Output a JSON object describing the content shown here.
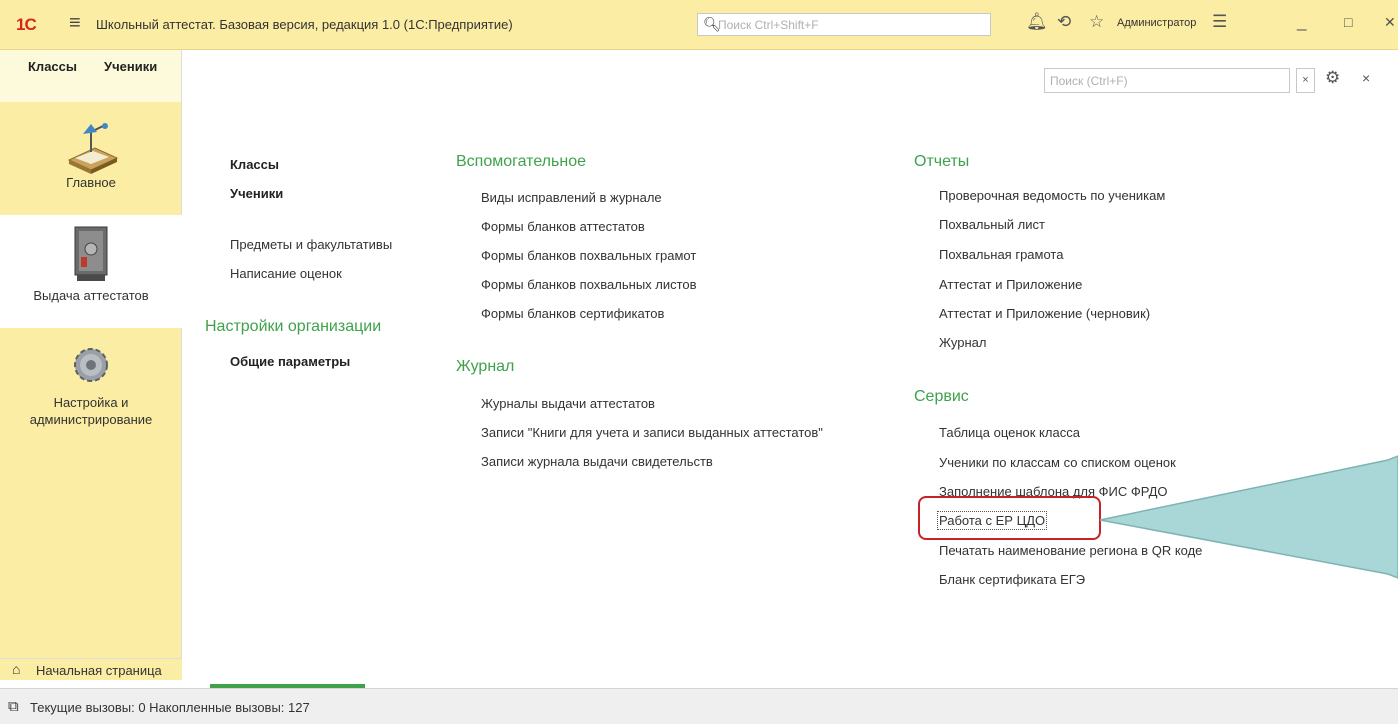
{
  "window": {
    "logo": "1С",
    "title": "Школьный аттестат. Базовая версия, редакция 1.0  (1С:Предприятие)",
    "search_placeholder": "Поиск Ctrl+Shift+F",
    "user": "Администратор",
    "minimize": "_",
    "maximize": "□",
    "close": "✕"
  },
  "section_tabs": [
    "Классы",
    "Ученики"
  ],
  "sidebar": {
    "items": [
      {
        "label": "Главное",
        "icon": "desk-lamp-icon"
      },
      {
        "label": "Выдача аттестатов",
        "icon": "safe-icon",
        "active": true
      },
      {
        "label": "Настройка и администрирование",
        "icon": "gears-icon"
      }
    ],
    "home": "Начальная страница"
  },
  "form": {
    "search_placeholder": "Поиск (Ctrl+F)",
    "clear": "×",
    "close": "×"
  },
  "columns": {
    "left": {
      "items": [
        "Классы",
        "Ученики",
        "Предметы и факультативы",
        "Написание оценок"
      ],
      "section": "Настройки организации",
      "section_items": [
        "Общие параметры"
      ]
    },
    "middle": {
      "section1": "Вспомогательное",
      "section1_items": [
        "Виды исправлений в журнале",
        "Формы бланков аттестатов",
        "Формы бланков похвальных грамот",
        "Формы бланков похвальных листов",
        "Формы бланков сертификатов"
      ],
      "section2": "Журнал",
      "section2_items": [
        "Журналы выдачи аттестатов",
        "Записи \"Книги для учета и записи выданных аттестатов\"",
        "Записи журнала выдачи свидетельств"
      ]
    },
    "right": {
      "section1": "Отчеты",
      "section1_items": [
        "Проверочная ведомость по ученикам",
        "Похвальный лист",
        "Похвальная грамота",
        "Аттестат и Приложение",
        "Аттестат и Приложение (черновик)",
        "Журнал"
      ],
      "section2": "Сервис",
      "section2_items": [
        "Таблица оценок класса",
        "Ученики по классам со списком оценок",
        "Заполнение шаблона для ФИС ФРДО",
        "Работа с ЕР ЦДО",
        "Печатать наименование региона в QR коде",
        "Бланк сертификата ЕГЭ"
      ]
    }
  },
  "status": {
    "text": "Текущие вызовы: 0   Накопленные вызовы: 127"
  },
  "colors": {
    "accent": "#3fa24b",
    "panel": "#fbeda3",
    "highlight": "#c62326",
    "callout": "#a9d6d6"
  }
}
